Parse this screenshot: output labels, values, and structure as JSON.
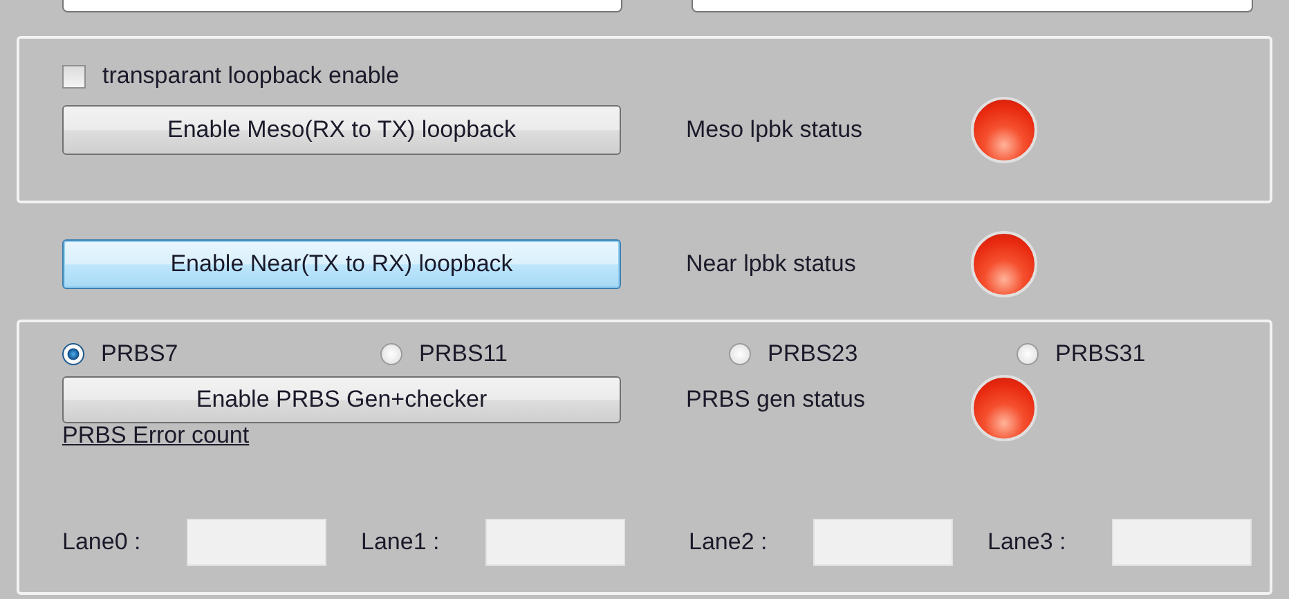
{
  "transparent_loopback": {
    "label": "transparant loopback enable",
    "checked": false
  },
  "loopbacks": [
    {
      "button": "Enable Meso(RX to TX) loopback",
      "status_label": "Meso lpbk status",
      "on": false,
      "focused": false
    },
    {
      "button": "Enable Near(TX to RX) loopback",
      "status_label": "Near lpbk status",
      "on": false,
      "focused": true
    }
  ],
  "prbs": {
    "options": [
      {
        "label": "PRBS7",
        "selected": true
      },
      {
        "label": "PRBS11",
        "selected": false
      },
      {
        "label": "PRBS23",
        "selected": false
      },
      {
        "label": "PRBS31",
        "selected": false
      }
    ],
    "button": "Enable PRBS Gen+checker",
    "status_label": "PRBS gen status",
    "on": false,
    "error_count_link": "PRBS Error count",
    "lanes": [
      {
        "label": "Lane0 :"
      },
      {
        "label": "Lane1 :"
      },
      {
        "label": "Lane2 :"
      },
      {
        "label": "Lane3 :"
      }
    ]
  }
}
